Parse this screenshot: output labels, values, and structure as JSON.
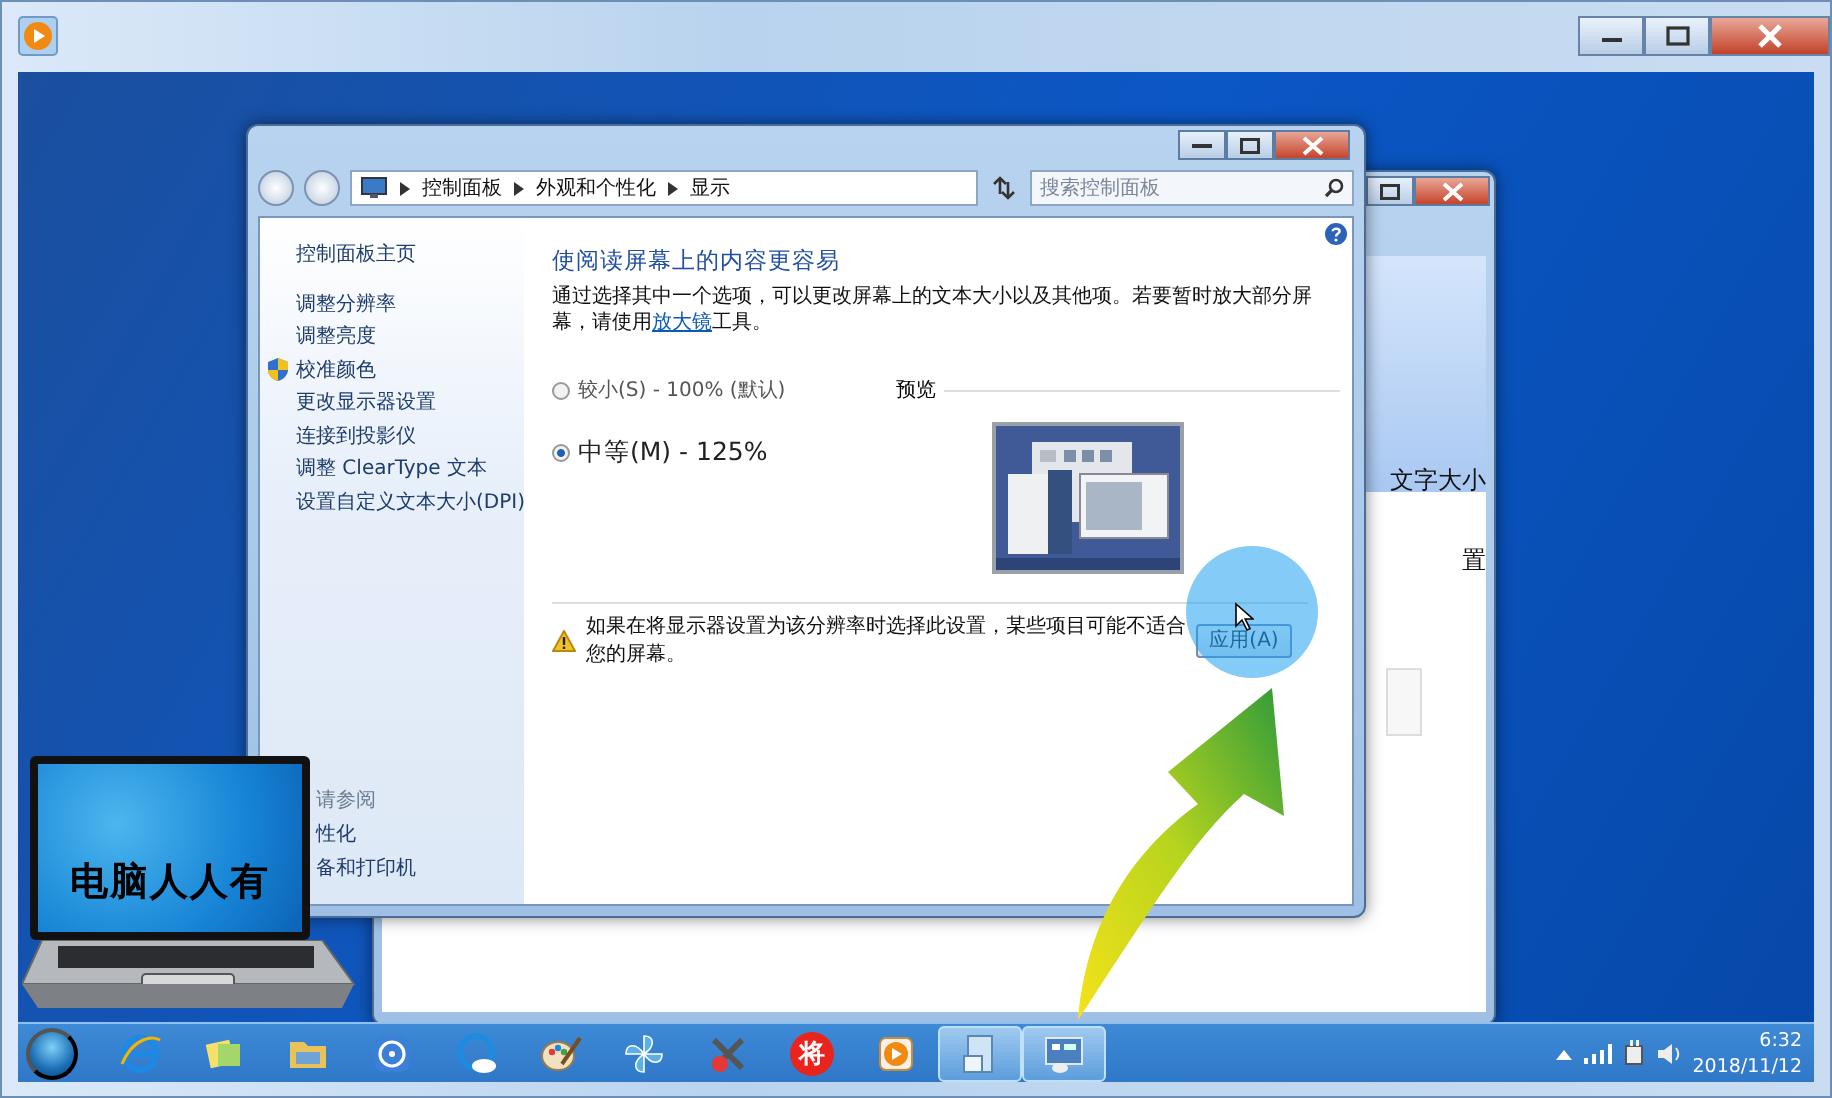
{
  "front_window": {
    "breadcrumb": [
      "控制面板",
      "外观和个性化",
      "显示"
    ],
    "search": {
      "placeholder": "搜索控制面板"
    },
    "sidebar": {
      "home": "控制面板主页",
      "tasks": [
        {
          "label": "调整分辨率",
          "kind": "plain"
        },
        {
          "label": "调整亮度",
          "kind": "plain"
        },
        {
          "label": "校准颜色",
          "kind": "shield"
        },
        {
          "label": "更改显示器设置",
          "kind": "plain"
        },
        {
          "label": "连接到投影仪",
          "kind": "plain"
        },
        {
          "label": "调整 ClearType 文本",
          "kind": "plain"
        },
        {
          "label": "设置自定义文本大小(DPI)",
          "kind": "plain"
        }
      ],
      "see_also_header": "请参阅",
      "see_also": [
        "性化",
        "备和打印机"
      ]
    },
    "main": {
      "title": "使阅读屏幕上的内容更容易",
      "description": {
        "before": "通过选择其中一个选项，可以更改屏幕上的文本大小以及其他项。若要暂时放大部分屏幕，请使用",
        "link": "放大镜",
        "after": "工具。"
      },
      "options": [
        {
          "label": "较小(S) - 100% (默认)",
          "selected": false
        },
        {
          "label": "中等(M) - 125%",
          "selected": true
        }
      ],
      "preview_label": "预览",
      "warning": "如果在将显示器设置为该分辨率时选择此设置，某些项目可能不适合您的屏幕。",
      "apply_button": "应用(A)"
    }
  },
  "back_window": {
    "texts": [
      "文字大小",
      "置"
    ]
  },
  "logo": {
    "text": "电脑人人有"
  },
  "taskbar": {
    "items": [
      {
        "kind": "ie",
        "selected": false
      },
      {
        "kind": "notes",
        "selected": false
      },
      {
        "kind": "folder",
        "selected": false
      },
      {
        "kind": "media",
        "selected": false
      },
      {
        "kind": "cloud",
        "selected": false
      },
      {
        "kind": "paint",
        "selected": false
      },
      {
        "kind": "pinwheel",
        "selected": false
      },
      {
        "kind": "tools",
        "selected": false
      },
      {
        "kind": "badge",
        "text": "将",
        "selected": false
      },
      {
        "kind": "play",
        "selected": false
      },
      {
        "kind": "window",
        "selected": true
      },
      {
        "kind": "display",
        "selected": true
      }
    ],
    "time": "6:32",
    "date": "2018/11/12"
  }
}
